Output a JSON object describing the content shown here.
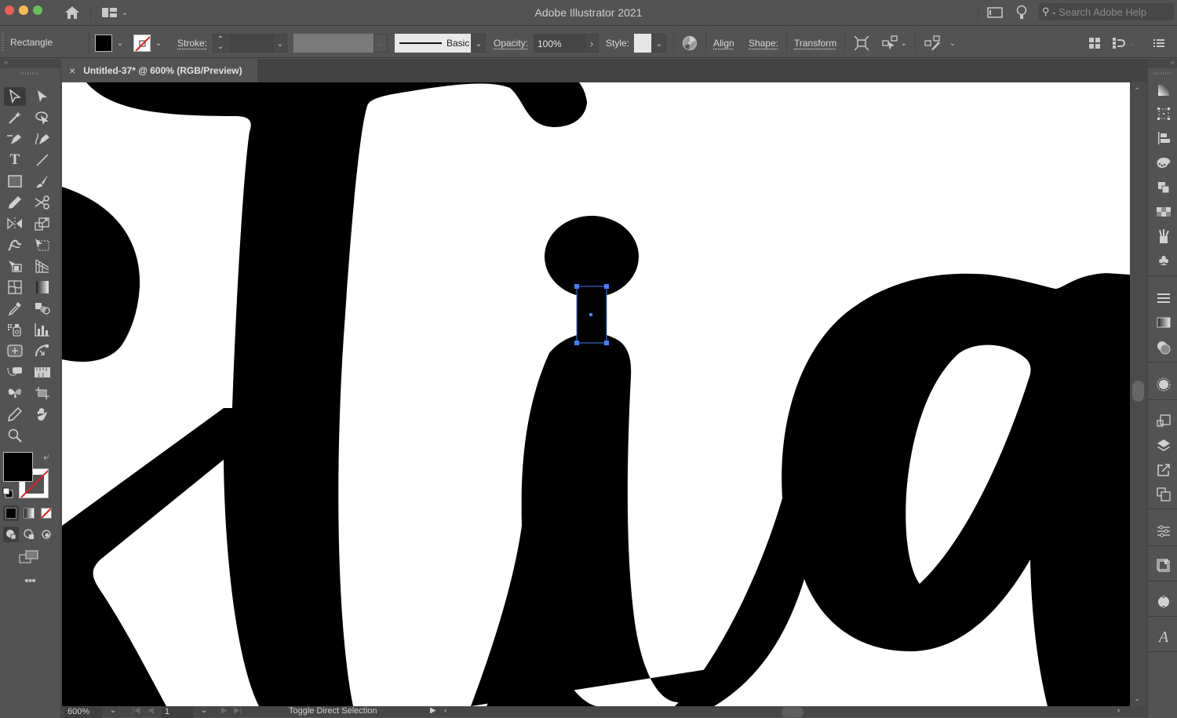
{
  "window": {
    "title": "Adobe Illustrator 2021",
    "search_placeholder": "Search Adobe Help"
  },
  "control_bar": {
    "selection_type": "Rectangle",
    "fill_color": "#000000",
    "stroke_label": "Stroke:",
    "stroke_weight": "",
    "brush_profile": "Basic",
    "opacity_label": "Opacity:",
    "opacity_value": "100%",
    "style_label": "Style:",
    "align_label": "Align",
    "shape_label": "Shape:",
    "transform_label": "Transform"
  },
  "document_tab": {
    "title": "Untitled-37* @ 600% (RGB/Preview)"
  },
  "tools": [
    "selection-tool",
    "direct-selection-tool",
    "magic-wand-tool",
    "lasso-tool",
    "pen-tool",
    "curvature-tool",
    "type-tool",
    "line-segment-tool",
    "rectangle-tool",
    "paintbrush-tool",
    "pencil-tool",
    "scissors-tool",
    "reflect-tool",
    "scale-tool",
    "warp-tool",
    "free-transform-tool",
    "shape-builder-tool",
    "perspective-grid-tool",
    "mesh-tool",
    "gradient-tool",
    "eyedropper-tool",
    "blend-tool",
    "symbol-sprayer-tool",
    "column-graph-tool",
    "artboard-tool",
    "slice-tool",
    "puppet-warp-tool",
    "measure-tool",
    "butterfly-tool",
    "crop-tool",
    "eraser-tool",
    "hand-tool",
    "zoom-tool"
  ],
  "colors": {
    "fill": "#000000",
    "stroke": "none",
    "selection_accent": "#4a7cf3"
  },
  "status_bar": {
    "zoom": "600%",
    "artboard_number": "1",
    "status_text": "Toggle Direct Selection"
  },
  "artwork": {
    "description": "Script lettering fragment 'Ha' with selected rectangle connecting i-dot"
  }
}
